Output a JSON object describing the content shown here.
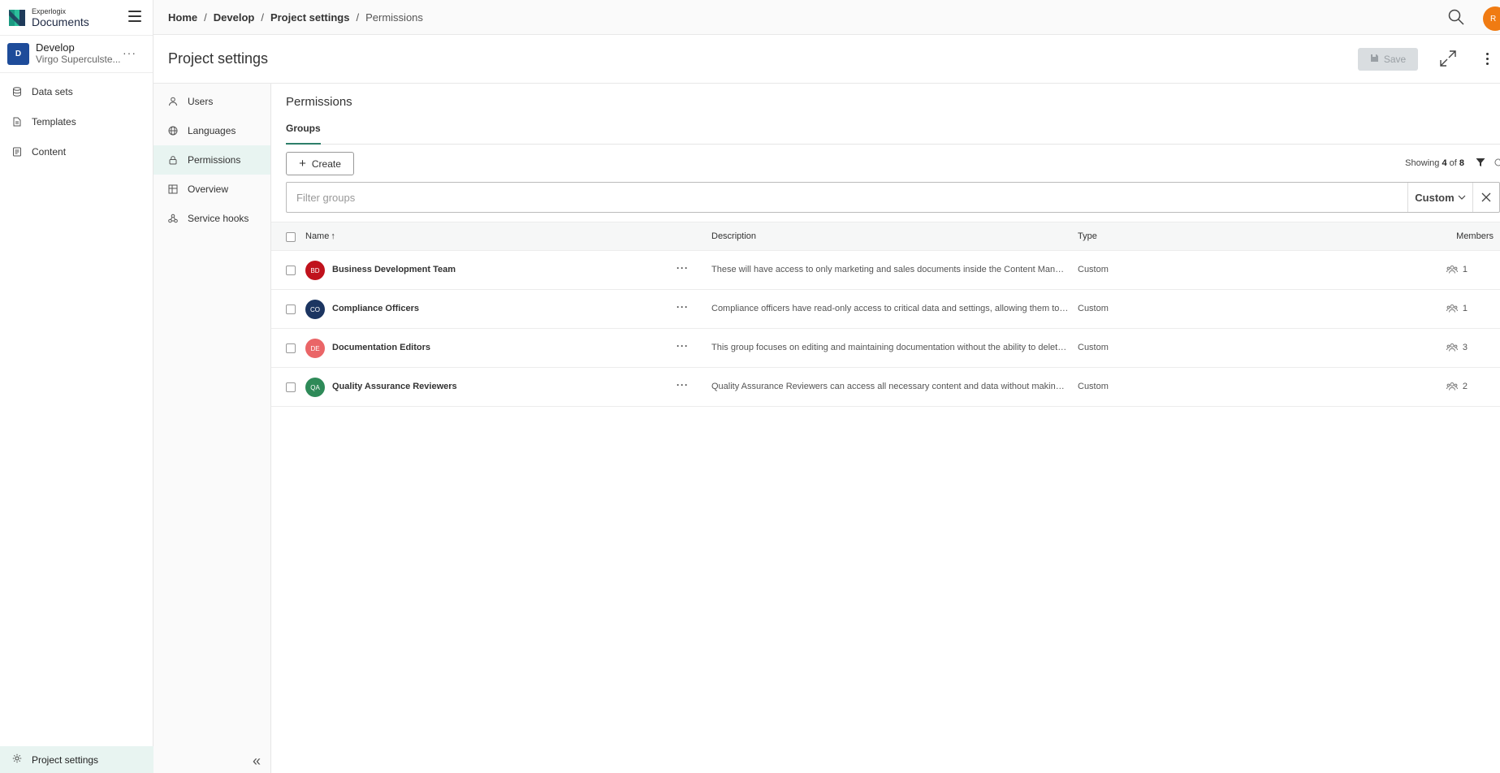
{
  "app": {
    "logo_small": "Experlogix",
    "logo_big": "Documents"
  },
  "project": {
    "initial": "D",
    "name": "Develop",
    "subtitle": "Virgo Superculste...",
    "more": "···"
  },
  "sidebar": {
    "items": [
      {
        "label": "Data sets",
        "icon": "database-icon"
      },
      {
        "label": "Templates",
        "icon": "template-icon"
      },
      {
        "label": "Content",
        "icon": "content-icon"
      }
    ],
    "bottom": {
      "label": "Project settings",
      "icon": "gear-icon"
    }
  },
  "breadcrumb": [
    "Home",
    "Develop",
    "Project settings",
    "Permissions"
  ],
  "user": {
    "initial": "R",
    "color": "#f07b12"
  },
  "page": {
    "title": "Project settings",
    "save_label": "Save"
  },
  "subnav": {
    "items": [
      {
        "label": "Users",
        "icon": "user-icon"
      },
      {
        "label": "Languages",
        "icon": "globe-icon"
      },
      {
        "label": "Permissions",
        "icon": "lock-icon",
        "active": true
      },
      {
        "label": "Overview",
        "icon": "grid-icon"
      },
      {
        "label": "Service hooks",
        "icon": "webhook-icon"
      }
    ],
    "collapse": "«"
  },
  "permissions": {
    "title": "Permissions",
    "tab": "Groups",
    "create_label": "Create",
    "showing_prefix": "Showing",
    "showing_count": "4",
    "showing_of": "of",
    "showing_total": "8",
    "filter_placeholder": "Filter groups",
    "filter_type": "Custom"
  },
  "table": {
    "headers": {
      "name": "Name",
      "sort": "↑",
      "description": "Description",
      "type": "Type",
      "members": "Members"
    },
    "rows": [
      {
        "initials": "BD",
        "color": "#c0121c",
        "name": "Business Development Team",
        "description": "These will have access to only marketing and sales documents inside the Content Management System.",
        "type": "Custom",
        "members": "1"
      },
      {
        "initials": "CO",
        "color": "#1c3561",
        "name": "Compliance Officers",
        "description": "Compliance officers have read-only access to critical data and settings, allowing them to review.",
        "type": "Custom",
        "members": "1"
      },
      {
        "initials": "DE",
        "color": "#ea6567",
        "name": "Documentation Editors",
        "description": "This group focuses on editing and maintaining documentation without the ability to delete content.",
        "type": "Custom",
        "members": "3"
      },
      {
        "initials": "QA",
        "color": "#2e8a58",
        "name": "Quality Assurance Reviewers",
        "description": "Quality Assurance Reviewers can access all necessary content and data without making changes.",
        "type": "Custom",
        "members": "2"
      }
    ],
    "row_more": "···"
  },
  "colors": {
    "accent": "#2e7f6a",
    "active_bg": "#e8f4f1",
    "project_badge": "#1e4c9a"
  }
}
